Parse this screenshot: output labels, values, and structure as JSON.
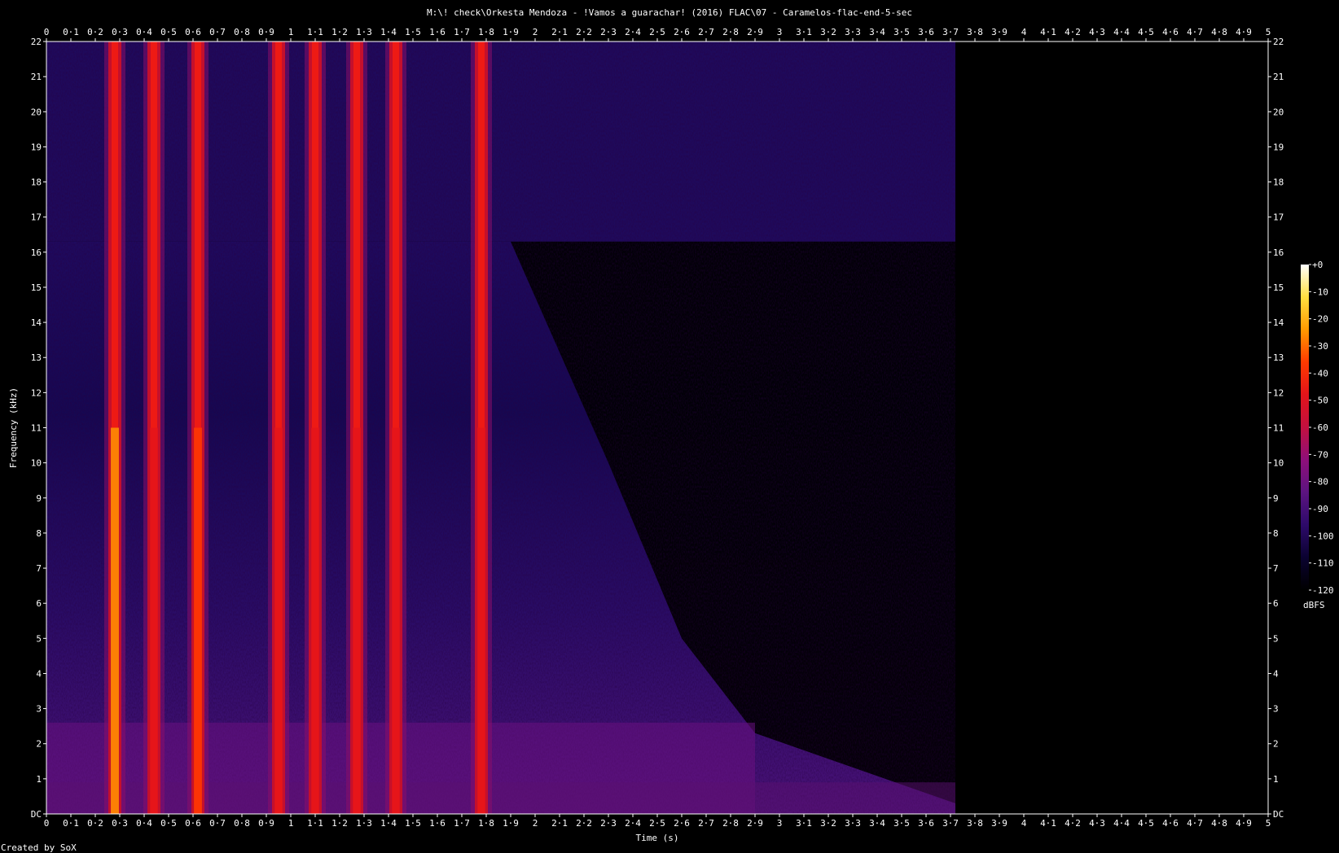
{
  "window": {
    "title": "M:\\! check\\Orkesta Mendoza - !Vamos a guarachar! (2016) FLAC\\07 - Caramelos-flac-end-5-sec"
  },
  "footer": {
    "credit": "Created by SoX"
  },
  "chart_data": {
    "type": "heatmap",
    "title": "M:\\! check\\Orkesta Mendoza - !Vamos a guarachar! (2016) FLAC\\07 - Caramelos-flac-end-5-sec",
    "xlabel": "Time (s)",
    "ylabel": "Frequency (kHz)",
    "xlim": [
      0,
      5
    ],
    "ylim": [
      0,
      22
    ],
    "x_ticks": [
      "0",
      "0·1",
      "0·2",
      "0·3",
      "0·4",
      "0·5",
      "0·6",
      "0·7",
      "0·8",
      "0·9",
      "1",
      "1·1",
      "1·2",
      "1·3",
      "1·4",
      "1·5",
      "1·6",
      "1·7",
      "1·8",
      "1·9",
      "2",
      "2·1",
      "2·2",
      "2·3",
      "2·4",
      "2·5",
      "2·6",
      "2·7",
      "2·8",
      "2·9",
      "3",
      "3·1",
      "3·2",
      "3·3",
      "3·4",
      "3·5",
      "3·6",
      "3·7",
      "3·8",
      "3·9",
      "4",
      "4·1",
      "4·2",
      "4·3",
      "4·4",
      "4·5",
      "4·6",
      "4·7",
      "4·8",
      "4·9",
      "5"
    ],
    "y_ticks": [
      "DC",
      "1",
      "2",
      "3",
      "4",
      "5",
      "6",
      "7",
      "8",
      "9",
      "10",
      "11",
      "12",
      "13",
      "14",
      "15",
      "16",
      "17",
      "18",
      "19",
      "20",
      "21",
      "22"
    ],
    "colorbar": {
      "unit": "dBFS",
      "range": [
        -120,
        0
      ],
      "ticks": [
        "+0",
        "-10",
        "-20",
        "-30",
        "-40",
        "-50",
        "-60",
        "-70",
        "-80",
        "-90",
        "-100",
        "-110",
        "-120"
      ]
    },
    "noise_floor": {
      "cutoff_freq_khz": 16.3,
      "end_time_s": 3.72
    },
    "transients": [
      {
        "time_s": 0.28,
        "peak_dbfs": -30
      },
      {
        "time_s": 0.44,
        "peak_dbfs": -50
      },
      {
        "time_s": 0.62,
        "peak_dbfs": -35
      },
      {
        "time_s": 0.95,
        "peak_dbfs": -45
      },
      {
        "time_s": 1.1,
        "peak_dbfs": -50
      },
      {
        "time_s": 1.27,
        "peak_dbfs": -50
      },
      {
        "time_s": 1.43,
        "peak_dbfs": -50
      },
      {
        "time_s": 1.78,
        "peak_dbfs": -50
      }
    ],
    "colors": [
      "#000000",
      "#0a0230",
      "#2d0a6a",
      "#5c1480",
      "#8e0f7a",
      "#c2103f",
      "#e3141a",
      "#ff3a00",
      "#ff9a00",
      "#ffe040",
      "#ffffff"
    ]
  }
}
